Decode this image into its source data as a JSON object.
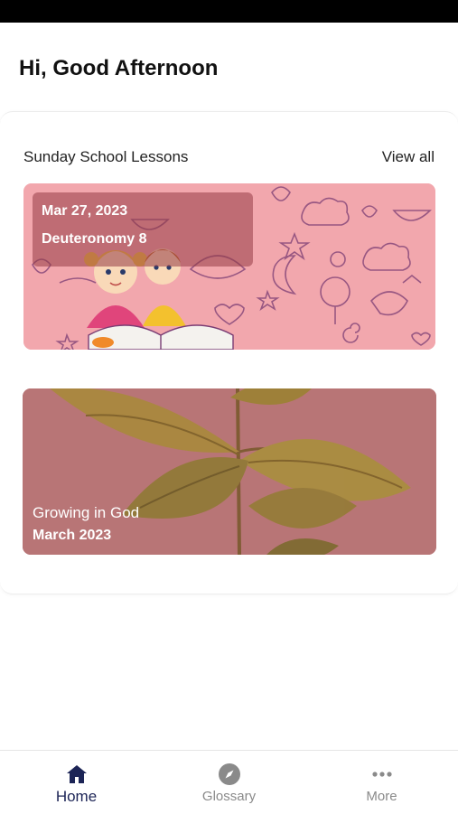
{
  "header": {
    "greeting": "Hi, Good Afternoon"
  },
  "section": {
    "title": "Sunday School Lessons",
    "view_all_label": "View all"
  },
  "lesson": {
    "date": "Mar 27, 2023",
    "reference": "Deuteronomy 8"
  },
  "series": {
    "title": "Growing in God",
    "date": "March 2023"
  },
  "tabs": [
    {
      "label": "Home",
      "icon": "home-icon",
      "active": true
    },
    {
      "label": "Glossary",
      "icon": "compass-icon",
      "active": false
    },
    {
      "label": "More",
      "icon": "more-dots-icon",
      "active": false
    }
  ],
  "colors": {
    "active_tab": "#1c2456",
    "inactive_tab": "#8a8a8a",
    "lesson_bg": "#f2a7ad",
    "series_bg": "#b87576"
  }
}
